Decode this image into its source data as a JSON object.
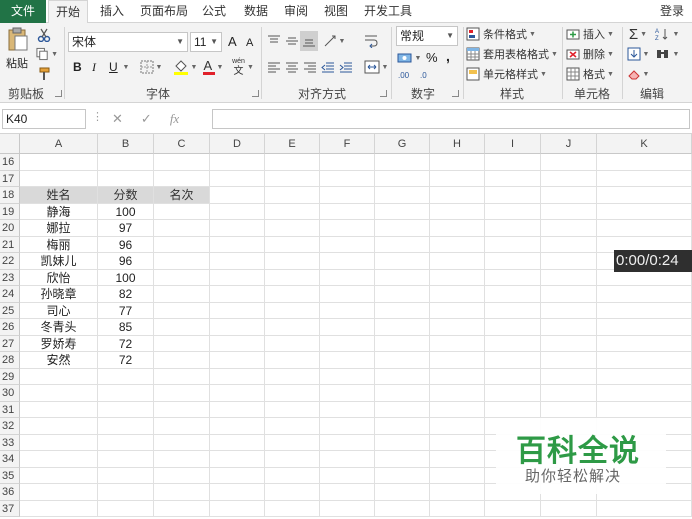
{
  "tabs": {
    "file": "文件",
    "home": "开始",
    "insert": "插入",
    "page_layout": "页面布局",
    "formulas": "公式",
    "data": "数据",
    "review": "审阅",
    "view": "视图",
    "developer": "开发工具",
    "login": "登录"
  },
  "ribbon": {
    "clipboard": {
      "paste": "粘贴",
      "label": "剪贴板"
    },
    "font": {
      "name": "宋体",
      "size": "11",
      "bold": "B",
      "italic": "I",
      "underline": "U",
      "grow": "A",
      "shrink": "A",
      "color_letter": "A",
      "label": "字体",
      "wen": "wén",
      "wen_char": "文"
    },
    "alignment": {
      "label": "对齐方式"
    },
    "number": {
      "format": "常规",
      "percent": "%",
      "comma": ",",
      "inc_decimal": ".00",
      "dec_decimal": ".0",
      "label": "数字"
    },
    "styles": {
      "conditional": "条件格式",
      "table": "套用表格格式",
      "cell": "单元格样式",
      "label": "样式"
    },
    "cells": {
      "insert": "插入",
      "delete": "删除",
      "format": "格式",
      "label": "单元格"
    },
    "editing": {
      "sum": "Σ",
      "label": "编辑"
    }
  },
  "formula_bar": {
    "name_box": "K40",
    "fx": "fx",
    "value": ""
  },
  "sheet": {
    "columns": [
      "A",
      "B",
      "C",
      "D",
      "E",
      "F",
      "G",
      "H",
      "I",
      "J",
      "K"
    ],
    "rows": [
      "16",
      "17",
      "18",
      "19",
      "20",
      "21",
      "22",
      "23",
      "24",
      "25",
      "26",
      "27",
      "28",
      "29",
      "30",
      "31",
      "32",
      "33",
      "34",
      "35",
      "36",
      "37"
    ],
    "header": {
      "name": "姓名",
      "score": "分数",
      "rank": "名次"
    },
    "records": [
      {
        "name": "静海",
        "score": "100"
      },
      {
        "name": "娜拉",
        "score": "97"
      },
      {
        "name": "梅丽",
        "score": "96"
      },
      {
        "name": "凯妹儿",
        "score": "96"
      },
      {
        "name": "欣怡",
        "score": "100"
      },
      {
        "name": "孙晓章",
        "score": "82"
      },
      {
        "name": "司心",
        "score": "77"
      },
      {
        "name": "冬青头",
        "score": "85"
      },
      {
        "name": "罗娇寿",
        "score": "72"
      },
      {
        "name": "安然",
        "score": "72"
      }
    ]
  },
  "video": {
    "time": "0:00/0:24"
  },
  "watermark": {
    "title": "百科全说",
    "subtitle": "助你轻松解决"
  },
  "colors": {
    "file_tab": "#217346",
    "header_fill": "#d9d9d9",
    "watermark": "#2e9a46"
  }
}
